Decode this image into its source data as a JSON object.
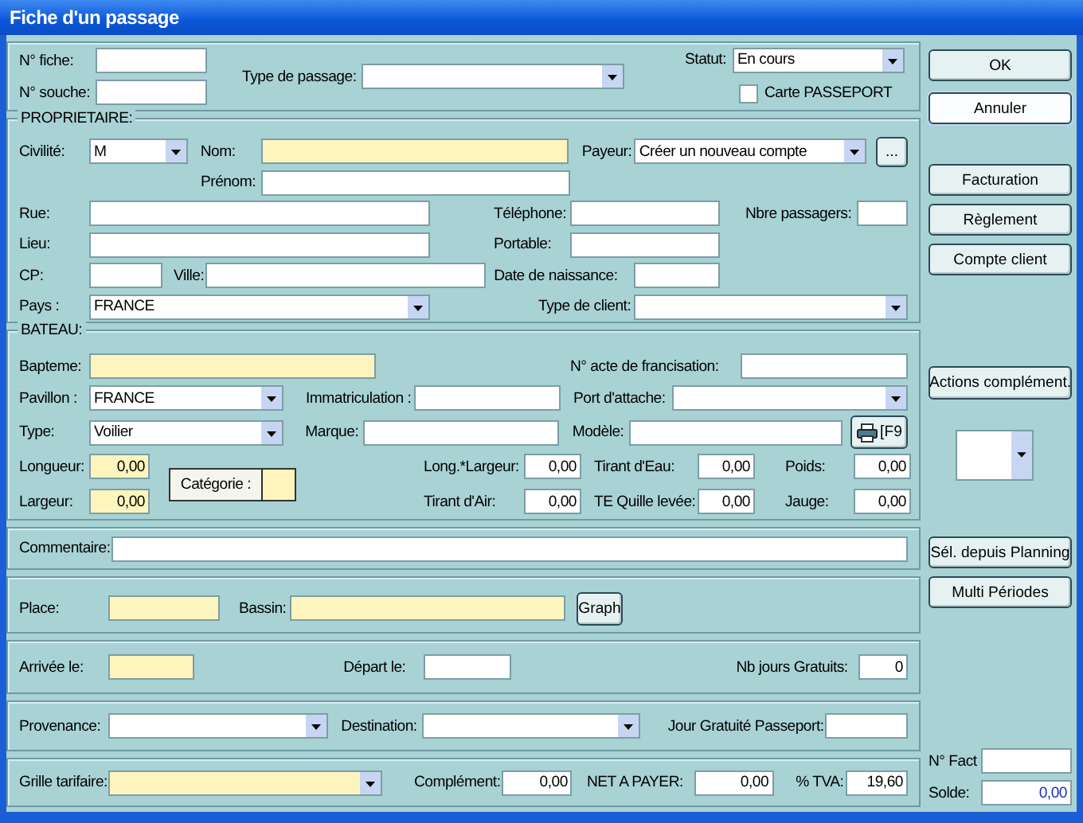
{
  "window": {
    "title": "Fiche d'un passage"
  },
  "header": {
    "fiche": {
      "label": "N° fiche:"
    },
    "souche": {
      "label": "N° souche:"
    },
    "type_passage": {
      "label": "Type de passage:"
    },
    "statut": {
      "label": "Statut:",
      "value": "En cours"
    },
    "carte_passeport": {
      "label": "Carte PASSEPORT",
      "checked": false
    }
  },
  "owner": {
    "legend": "PROPRIETAIRE:",
    "civilite": {
      "label": "Civilité:",
      "value": "M"
    },
    "nom": {
      "label": "Nom:",
      "required": true
    },
    "payeur": {
      "label": "Payeur:",
      "value": "Créer un nouveau compte"
    },
    "browse_button": "...",
    "prenom": {
      "label": "Prénom:"
    },
    "rue": {
      "label": "Rue:"
    },
    "telephone": {
      "label": "Téléphone:"
    },
    "nbre_passagers": {
      "label": "Nbre passagers:"
    },
    "lieu": {
      "label": "Lieu:"
    },
    "portable": {
      "label": "Portable:"
    },
    "cp": {
      "label": "CP:"
    },
    "ville": {
      "label": "Ville:"
    },
    "date_naissance": {
      "label": "Date de naissance:"
    },
    "pays": {
      "label": "Pays :",
      "value": "FRANCE"
    },
    "type_client": {
      "label": "Type de client:"
    }
  },
  "boat": {
    "legend": "BATEAU:",
    "bapteme": {
      "label": "Bapteme:",
      "required": true
    },
    "acte": {
      "label": "N° acte de francisation:"
    },
    "pavillon": {
      "label": "Pavillon :",
      "value": "FRANCE"
    },
    "immatriculation": {
      "label": "Immatriculation :"
    },
    "port": {
      "label": "Port d'attache:"
    },
    "type": {
      "label": "Type:",
      "value": "Voilier"
    },
    "marque": {
      "label": "Marque:"
    },
    "modele": {
      "label": "Modèle:"
    },
    "f9_button": "[F9",
    "longueur": {
      "label": "Longueur:",
      "value": "0,00",
      "required": true
    },
    "largeur": {
      "label": "Largeur:",
      "value": "0,00",
      "required": true
    },
    "categorie": {
      "label": "Catégorie :",
      "required": true
    },
    "long_largeur": {
      "label": "Long.*Largeur:",
      "value": "0,00"
    },
    "tirant_eau": {
      "label": "Tirant d'Eau:",
      "value": "0,00"
    },
    "poids": {
      "label": "Poids:",
      "value": "0,00"
    },
    "tirant_air": {
      "label": "Tirant d'Air:",
      "value": "0,00"
    },
    "te_quille": {
      "label": "TE Quille levée:",
      "value": "0,00"
    },
    "jauge": {
      "label": "Jauge:",
      "value": "0,00"
    }
  },
  "comment": {
    "label": "Commentaire:"
  },
  "berth": {
    "place": {
      "label": "Place:",
      "required": true
    },
    "bassin": {
      "label": "Bassin:",
      "required": true
    },
    "graph_button": "Graph"
  },
  "stay": {
    "arrivee": {
      "label": "Arrivée le:",
      "required": true
    },
    "depart": {
      "label": "Départ le:"
    },
    "jours_gratuits": {
      "label": "Nb jours Gratuits:",
      "value": "0"
    }
  },
  "route": {
    "provenance": {
      "label": "Provenance:"
    },
    "destination": {
      "label": "Destination:"
    },
    "jour_gratuite": {
      "label": "Jour Gratuité Passeport:"
    }
  },
  "pricing": {
    "grille": {
      "label": "Grille tarifaire:",
      "required": true
    },
    "complement": {
      "label": "Complément:",
      "value": "0,00"
    },
    "net": {
      "label": "NET A PAYER:",
      "value": "0,00"
    },
    "tva": {
      "label": "% TVA:",
      "value": "19,60"
    }
  },
  "side": {
    "buttons": [
      {
        "label": "OK",
        "focused": false
      },
      {
        "label": "Annuler",
        "focused": true
      },
      {
        "label": "Facturation",
        "focused": false
      },
      {
        "label": "Règlement",
        "focused": false
      },
      {
        "label": "Compte client",
        "focused": false
      },
      {
        "label": "Actions complément.",
        "focused": false
      },
      {
        "label": "Sél. depuis Planning",
        "focused": false
      },
      {
        "label": "Multi Périodes",
        "focused": false
      }
    ],
    "n_fact": {
      "label": "N° Fact"
    },
    "solde": {
      "label": "Solde:",
      "value": "0,00"
    }
  }
}
